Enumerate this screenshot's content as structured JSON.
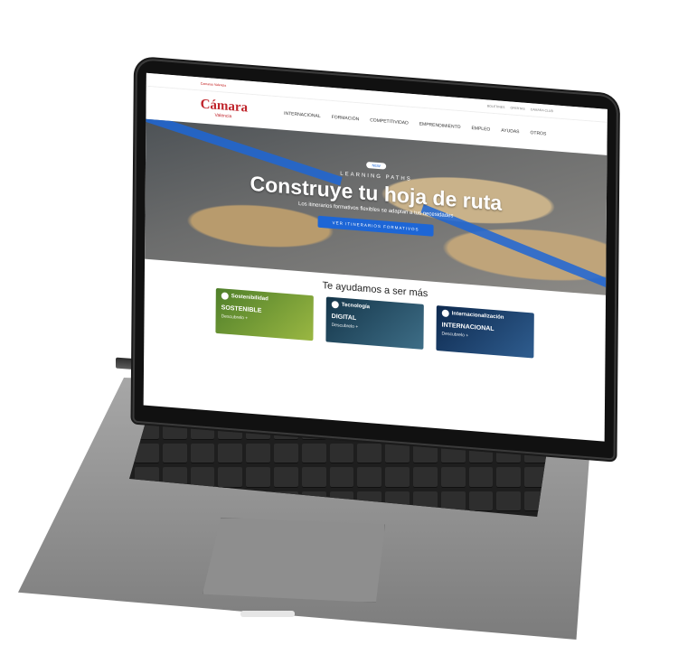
{
  "site": {
    "topbar_left": "Camaras   Valencia",
    "topbar_right": [
      "BOLETINES",
      "OFERTAS",
      "CAMARA CLUB"
    ],
    "logo_main": "Cámara",
    "logo_sub": "Valencia",
    "nav": [
      "INTERNACIONAL",
      "FORMACIÓN",
      "COMPETITIVIDAD",
      "EMPRENDIMIENTO",
      "EMPLEO",
      "AYUDAS",
      "OTROS"
    ]
  },
  "hero": {
    "badge": "NEW",
    "kicker": "LEARNING PATHS",
    "headline": "Construye tu hoja de ruta",
    "sub": "Los itinerarios formativos flexibles se adaptan a tus necesidades",
    "cta": "VER ITINERARIOS FORMATIVOS"
  },
  "section_title": "Te ayudamos a ser más",
  "cards": [
    {
      "tag": "Sostenibilidad",
      "title": "SOSTENIBLE",
      "more": "Descubrelo +"
    },
    {
      "tag": "Tecnología",
      "title": "DIGITAL",
      "more": "Descubrelo +"
    },
    {
      "tag": "Internacionalización",
      "title": "INTERNACIONAL",
      "more": "Descubrelo +"
    }
  ],
  "colors": {
    "brand": "#c0252c",
    "accent": "#1d66d6"
  }
}
